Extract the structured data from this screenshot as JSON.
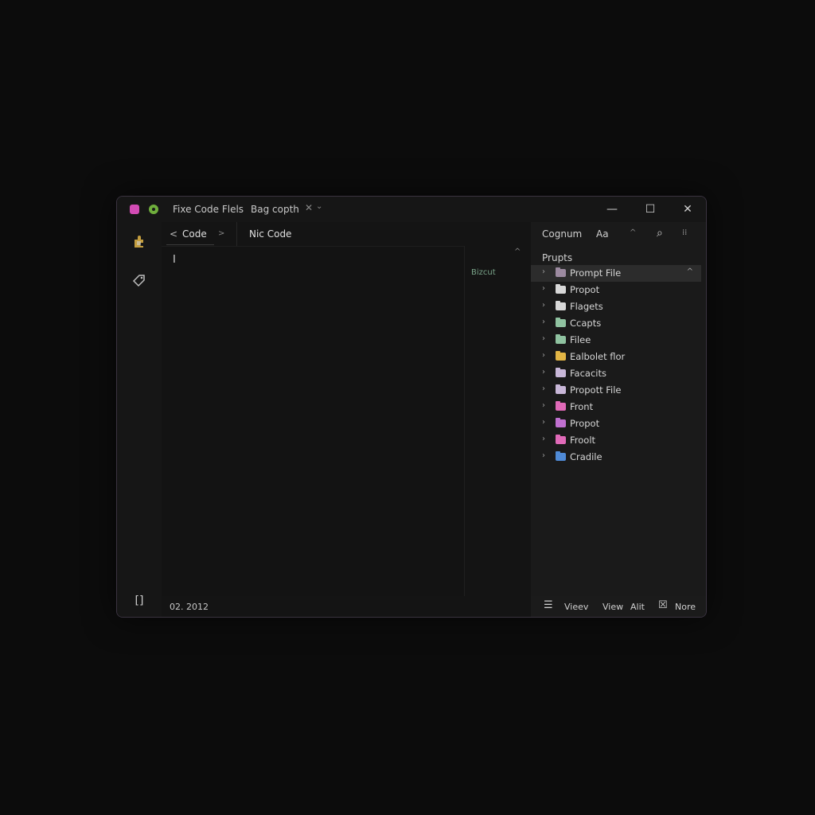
{
  "titlebar": {
    "title_primary": "Fixe Code Flels",
    "title_secondary": "Bag copth",
    "close_tab_glyph": "✕",
    "dropdown_glyph": "⌄",
    "minimize_glyph": "—",
    "maximize_glyph": "☐",
    "close_glyph": "✕",
    "accent_pink": "#d24bb4",
    "accent_green": "#6fae3c"
  },
  "activity_bar": {
    "icons": [
      "puzzle-icon",
      "tag-icon"
    ],
    "bottom_glyph": "[]"
  },
  "editor": {
    "tab_back_glyph": "<",
    "tab_label": "Code",
    "tab_forward_glyph": ">",
    "tab_secondary": "Nic Code",
    "cursor_text": "I",
    "minimap_label": "Bizcut",
    "minimap_up_glyph": "^",
    "status": "02. 2012"
  },
  "panel": {
    "header_title": "Cognum",
    "header_secondary": "Aa",
    "header_chevron": "^",
    "search_glyph": "⌕",
    "more_glyph": "⁞⁞",
    "section_title": "Prupts",
    "items": [
      {
        "label": "Prompt File",
        "color": "#9c8aa0",
        "selected": true
      },
      {
        "label": "Propot",
        "color": "#d8d8d8",
        "selected": false
      },
      {
        "label": "Flagets",
        "color": "#d8d8d8",
        "selected": false
      },
      {
        "label": "Ccapts",
        "color": "#8fc2a0",
        "selected": false
      },
      {
        "label": "Filee",
        "color": "#8fc2a0",
        "selected": false
      },
      {
        "label": "Ealbolet flor",
        "color": "#e2b545",
        "selected": false
      },
      {
        "label": "Facacits",
        "color": "#c8b7d8",
        "selected": false
      },
      {
        "label": "Propott File",
        "color": "#c8b7d8",
        "selected": false
      },
      {
        "label": "Front",
        "color": "#e06ab8",
        "selected": false
      },
      {
        "label": "Propot",
        "color": "#c070d0",
        "selected": false
      },
      {
        "label": "Froolt",
        "color": "#e06ab8",
        "selected": false
      },
      {
        "label": "Cradile",
        "color": "#4f8ad6",
        "selected": false
      }
    ],
    "bottom": {
      "menu_glyph": "☰",
      "view_a": "Vieev",
      "view_b": "View",
      "alt": "Alit",
      "box_glyph": "☒",
      "none": "Nore"
    }
  }
}
